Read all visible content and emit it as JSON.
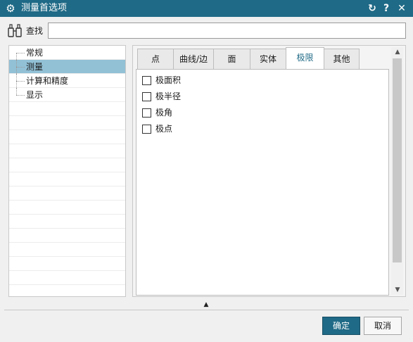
{
  "window": {
    "title": "测量首选项",
    "app_icon": "gear-icon",
    "buttons": {
      "reset_icon": "reset-icon",
      "help_label": "?",
      "close_label": "✕"
    }
  },
  "search": {
    "label": "查找",
    "icon": "binoculars-icon",
    "value": ""
  },
  "tree": {
    "items": [
      {
        "label": "常规",
        "selected": false
      },
      {
        "label": "测量",
        "selected": true
      },
      {
        "label": "计算和精度",
        "selected": false
      },
      {
        "label": "显示",
        "selected": false
      }
    ]
  },
  "tabs": [
    {
      "label": "点"
    },
    {
      "label": "曲线/边"
    },
    {
      "label": "面"
    },
    {
      "label": "实体"
    },
    {
      "label": "极限",
      "active": true
    },
    {
      "label": "其他"
    }
  ],
  "options": [
    {
      "label": "极面积",
      "checked": false
    },
    {
      "label": "极半径",
      "checked": false
    },
    {
      "label": "极角",
      "checked": false
    },
    {
      "label": "极点",
      "checked": false
    }
  ],
  "footer": {
    "ok_label": "确定",
    "cancel_label": "取消"
  },
  "colors": {
    "title_bar": "#1f6a86",
    "selection": "#92c1d6",
    "primary_button": "#1f6a86"
  }
}
